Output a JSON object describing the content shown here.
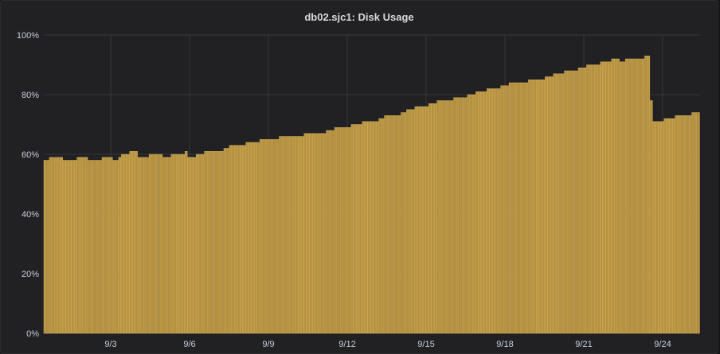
{
  "panel": {
    "title": "db02.sjc1: Disk Usage"
  },
  "colors": {
    "background": "#212124",
    "bar_fill": "#b5923f",
    "bar_stroke": "#d7b05a",
    "grid": "#36363a",
    "text": "#c7d0d9"
  },
  "chart_data": {
    "type": "bar",
    "title": "db02.sjc1: Disk Usage",
    "xlabel": "",
    "ylabel": "",
    "ylim": [
      0,
      100
    ],
    "y_unit": "%",
    "y_ticks": [
      0,
      20,
      40,
      60,
      80,
      100
    ],
    "y_tick_labels": [
      "0%",
      "20%",
      "40%",
      "60%",
      "80%",
      "100%"
    ],
    "x_ticks": [
      "9/3",
      "9/6",
      "9/9",
      "9/12",
      "9/15",
      "9/18",
      "9/21",
      "9/24"
    ],
    "x_range": [
      "8/31",
      "9/25"
    ],
    "grid": true,
    "legend": "none",
    "series": [
      {
        "values": [
          58,
          58,
          59,
          59,
          59,
          59,
          59,
          58,
          58,
          58,
          58,
          58,
          59,
          59,
          59,
          59,
          58,
          58,
          58,
          58,
          58,
          59,
          59,
          59,
          59,
          58,
          58,
          59,
          60,
          60,
          60,
          61,
          61,
          61,
          59,
          59,
          59,
          59,
          60,
          60,
          60,
          60,
          60,
          59,
          59,
          59,
          60,
          60,
          60,
          60,
          60,
          61,
          59,
          59,
          59,
          60,
          60,
          60,
          61,
          61,
          61,
          61,
          61,
          61,
          61,
          62,
          62,
          63,
          63,
          63,
          63,
          63,
          63,
          64,
          64,
          64,
          64,
          64,
          65,
          65,
          65,
          65,
          65,
          65,
          65,
          66,
          66,
          66,
          66,
          66,
          66,
          66,
          66,
          66,
          67,
          67,
          67,
          67,
          67,
          67,
          67,
          67,
          68,
          68,
          68,
          69,
          69,
          69,
          69,
          69,
          69,
          70,
          70,
          70,
          70,
          71,
          71,
          71,
          71,
          71,
          71,
          72,
          72,
          73,
          73,
          73,
          73,
          73,
          73,
          74,
          74,
          75,
          75,
          75,
          76,
          76,
          76,
          76,
          76,
          77,
          77,
          77,
          78,
          78,
          78,
          78,
          78,
          78,
          79,
          79,
          79,
          79,
          79,
          80,
          80,
          80,
          81,
          81,
          81,
          81,
          82,
          82,
          82,
          82,
          82,
          83,
          83,
          83,
          84,
          84,
          84,
          84,
          84,
          84,
          84,
          85,
          85,
          85,
          85,
          85,
          85,
          86,
          86,
          86,
          87,
          87,
          87,
          87,
          88,
          88,
          88,
          88,
          88,
          89,
          89,
          89,
          90,
          90,
          90,
          90,
          90,
          91,
          91,
          91,
          91,
          92,
          92,
          92,
          91,
          91,
          92,
          92,
          92,
          92,
          92,
          92,
          92,
          93,
          93,
          78,
          71,
          71,
          71,
          71,
          72,
          72,
          72,
          72,
          73,
          73,
          73,
          73,
          73,
          73,
          74,
          74,
          74
        ]
      }
    ]
  }
}
